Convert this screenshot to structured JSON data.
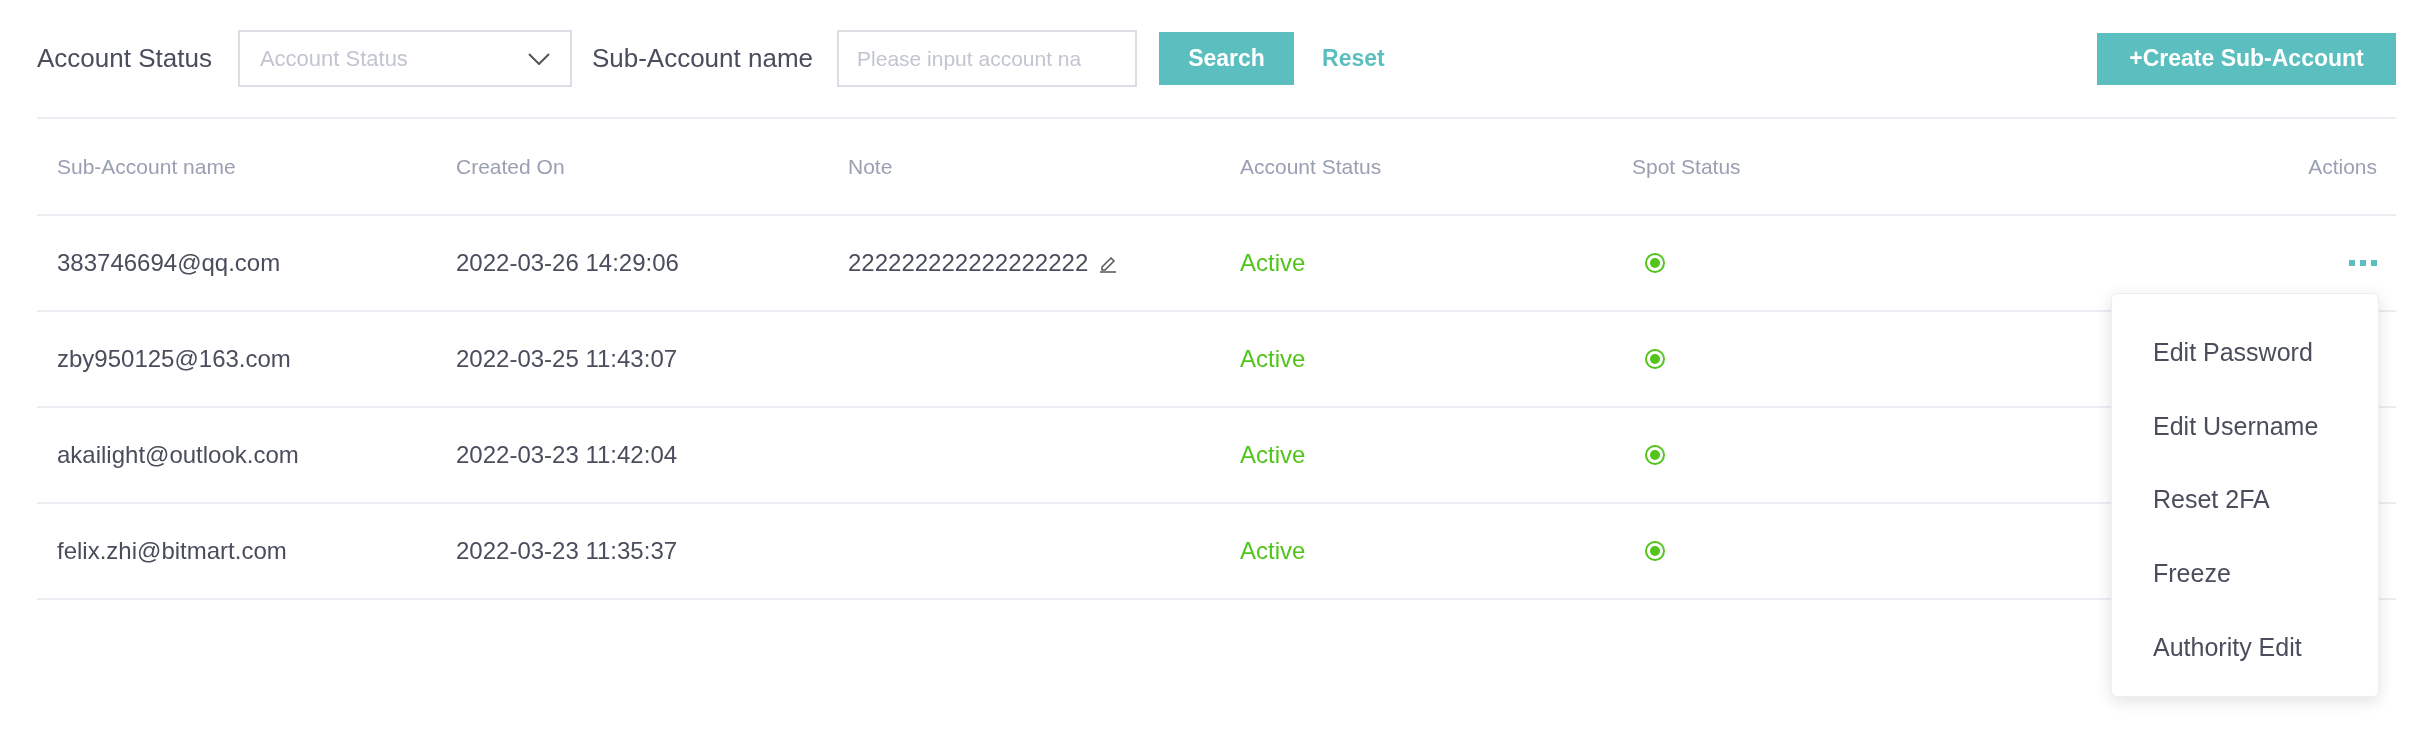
{
  "filters": {
    "status_label": "Account Status",
    "status_select": {
      "placeholder": "Account Status"
    },
    "name_label": "Sub-Account name",
    "name_input": {
      "placeholder": "Please input account na"
    },
    "search_button": "Search",
    "reset_link": "Reset",
    "create_button": "+Create Sub-Account"
  },
  "table": {
    "columns": [
      "Sub-Account name",
      "Created On",
      "Note",
      "Account Status",
      "Spot Status",
      "Actions"
    ],
    "rows": [
      {
        "name": "383746694@qq.com",
        "created": "2022-03-26 14:29:06",
        "note": "222222222222222222",
        "status": "Active",
        "spot_on": true,
        "menu_open": true
      },
      {
        "name": "zby950125@163.com",
        "created": "2022-03-25 11:43:07",
        "status": "Active",
        "spot_on": true,
        "menu_open": false
      },
      {
        "name": "akailight@outlook.com",
        "created": "2022-03-23 11:42:04",
        "status": "Active",
        "spot_on": true,
        "menu_open": false
      },
      {
        "name": "felix.zhi@bitmart.com",
        "created": "2022-03-23 11:35:37",
        "status": "Active",
        "spot_on": true,
        "menu_open": false
      }
    ]
  },
  "actions_menu": [
    "Edit Password",
    "Edit Username",
    "Reset 2FA",
    "Freeze",
    "Authority Edit"
  ]
}
